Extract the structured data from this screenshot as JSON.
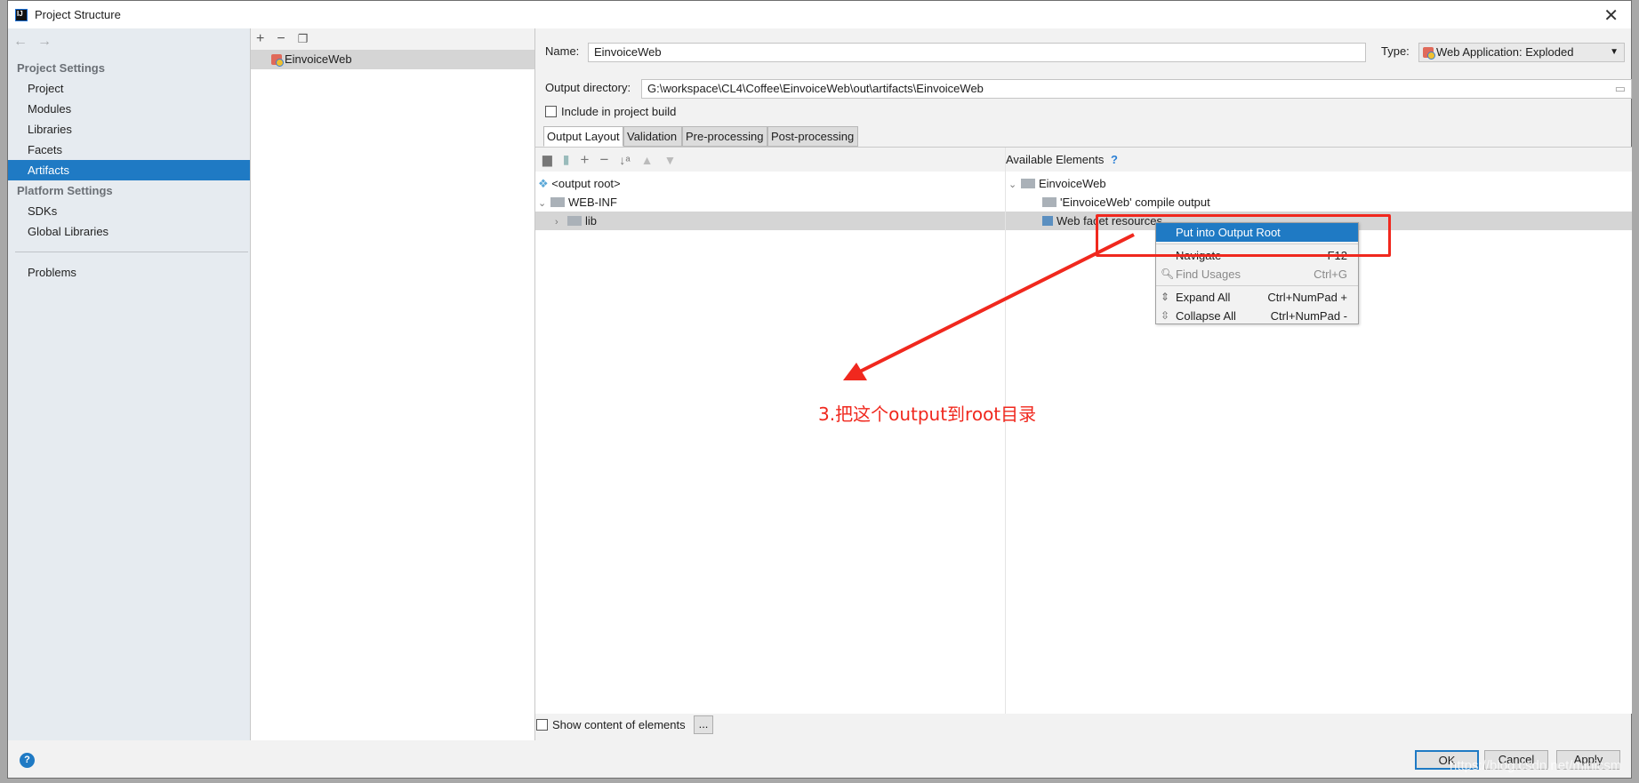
{
  "window": {
    "title": "Project Structure"
  },
  "sidebar": {
    "project_settings": "Project Settings",
    "items": [
      {
        "label": "Project"
      },
      {
        "label": "Modules"
      },
      {
        "label": "Libraries"
      },
      {
        "label": "Facets"
      },
      {
        "label": "Artifacts",
        "selected": true
      }
    ],
    "platform_settings": "Platform Settings",
    "platform_items": [
      {
        "label": "SDKs"
      },
      {
        "label": "Global Libraries"
      }
    ],
    "problems": "Problems"
  },
  "artifacts_list": {
    "items": [
      "EinvoiceWeb"
    ]
  },
  "detail": {
    "name_label": "Name:",
    "name_value": "EinvoiceWeb",
    "type_label": "Type:",
    "type_value": "Web Application: Exploded",
    "output_dir_label": "Output directory:",
    "output_dir_value": "G:\\workspace\\CL4\\Coffee\\EinvoiceWeb\\out\\artifacts\\EinvoiceWeb",
    "include_build": "Include in project build",
    "include_build_checked": false,
    "tabs": [
      "Output Layout",
      "Validation",
      "Pre-processing",
      "Post-processing"
    ],
    "active_tab": "Output Layout",
    "layout_tree": [
      "<output root>",
      "WEB-INF",
      "lib"
    ],
    "available_label": "Available Elements",
    "available_tree": [
      "EinvoiceWeb",
      "'EinvoiceWeb' compile output",
      "Web facet resources"
    ],
    "show_content": "Show content of elements",
    "more_btn": "..."
  },
  "context_menu": {
    "items": [
      {
        "label": "Put into Output Root",
        "shortcut": "",
        "highlighted": true
      },
      {
        "label": "Navigate",
        "shortcut": "F12"
      },
      {
        "label": "Find Usages",
        "shortcut": "Ctrl+G",
        "disabled": true
      },
      {
        "label": "Expand All",
        "shortcut": "Ctrl+NumPad +"
      },
      {
        "label": "Collapse All",
        "shortcut": "Ctrl+NumPad -"
      }
    ]
  },
  "annotation": {
    "text": "3.把这个output到root目录",
    "color": "#f0281e"
  },
  "footer": {
    "ok": "OK",
    "cancel": "Cancel",
    "apply": "Apply"
  },
  "watermark": "https://blog.csdn.net/minicsm",
  "colors": {
    "accent": "#1f7ac4",
    "annotation": "#f0281e"
  }
}
